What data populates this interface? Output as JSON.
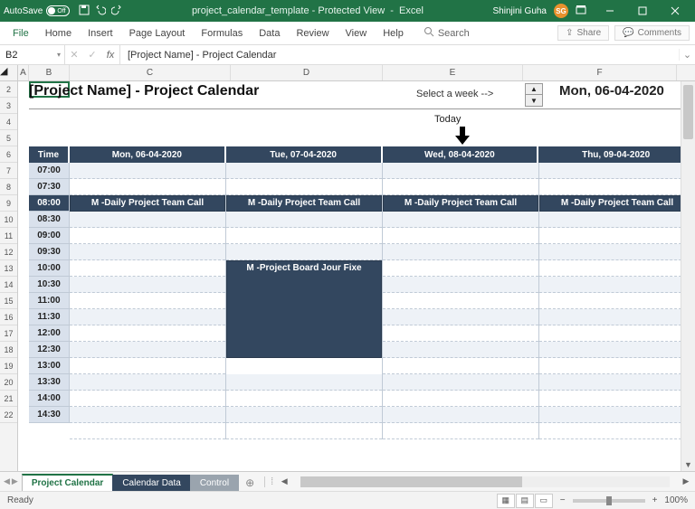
{
  "titlebar": {
    "autosave_label": "AutoSave",
    "autosave_state": "Off",
    "filename": "project_calendar_template",
    "mode": "Protected View",
    "app": "Excel",
    "user_name": "Shinjini Guha",
    "user_initials": "SG"
  },
  "ribbon": {
    "tabs": [
      "File",
      "Home",
      "Insert",
      "Page Layout",
      "Formulas",
      "Data",
      "Review",
      "View",
      "Help"
    ],
    "search_placeholder": "Search",
    "share_label": "Share",
    "comments_label": "Comments"
  },
  "formula_bar": {
    "name_box": "B2",
    "formula": "[Project Name] - Project Calendar"
  },
  "columns": [
    "A",
    "B",
    "C",
    "D",
    "E",
    "F"
  ],
  "rows_visible": [
    "2",
    "3",
    "4",
    "5",
    "6",
    "7",
    "8",
    "9",
    "10",
    "11",
    "12",
    "13",
    "14",
    "15",
    "16",
    "17",
    "18",
    "19",
    "20",
    "21",
    "22"
  ],
  "content": {
    "title": "[Project Name] - Project Calendar",
    "select_week_label": "Select a week -->",
    "week_start": "Mon, 06-04-2020",
    "today_label": "Today",
    "time_header": "Time",
    "day_headers": [
      "Mon, 06-04-2020",
      "Tue, 07-04-2020",
      "Wed, 08-04-2020",
      "Thu, 09-04-2020"
    ],
    "time_slots": [
      "07:00",
      "07:30",
      "08:00",
      "08:30",
      "09:00",
      "09:30",
      "10:00",
      "10:30",
      "11:00",
      "11:30",
      "12:00",
      "12:30",
      "13:00",
      "13:30",
      "14:00",
      "14:30"
    ],
    "selected_slot": "08:00",
    "events": {
      "daily_call": "M -Daily Project Team Call",
      "board": "M -Project Board Jour Fixe"
    }
  },
  "sheet_tabs": [
    "Project Calendar",
    "Calendar Data",
    "Control"
  ],
  "active_sheet": "Project Calendar",
  "status": {
    "left": "Ready",
    "zoom": "100%"
  }
}
